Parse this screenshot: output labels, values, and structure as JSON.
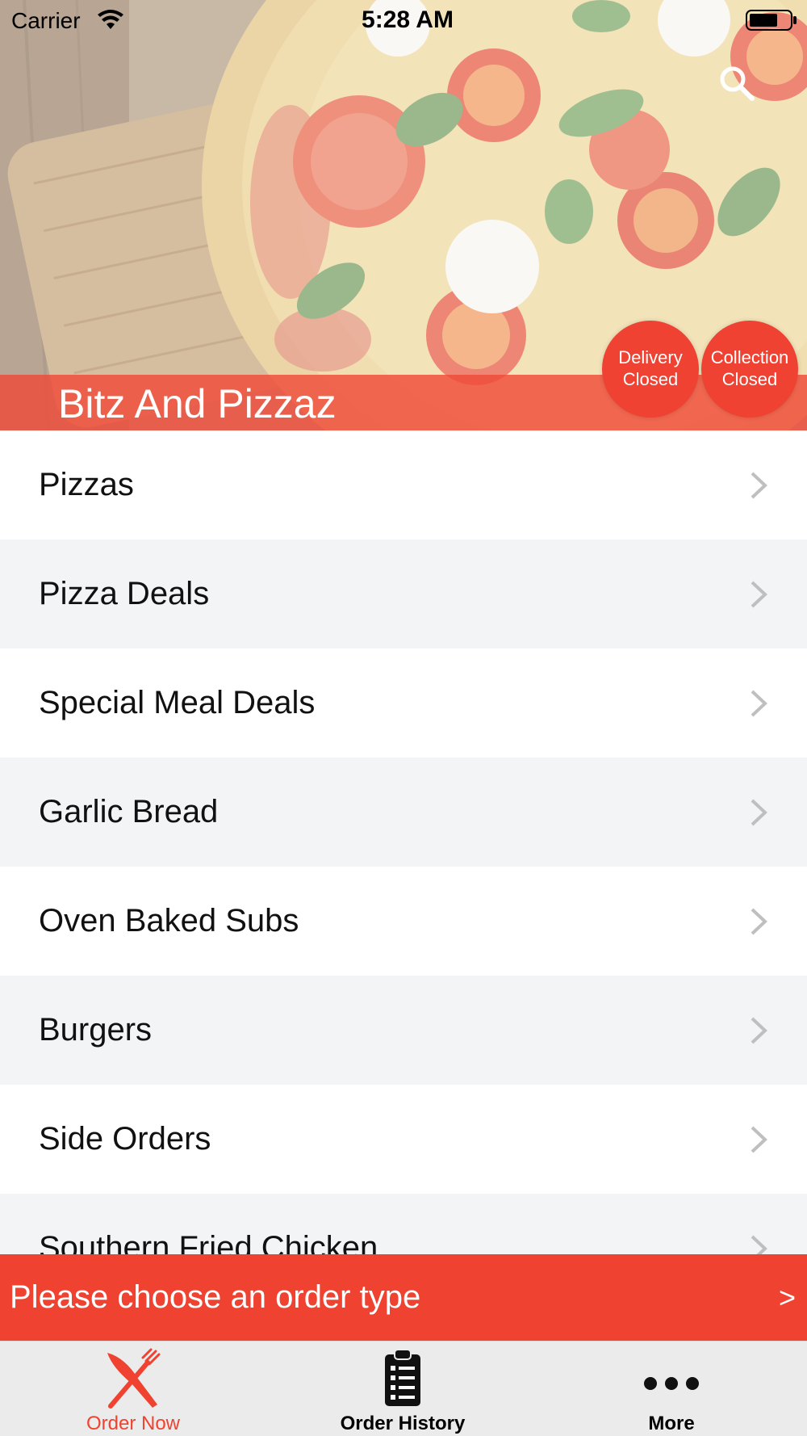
{
  "status_bar": {
    "carrier": "Carrier",
    "time": "5:28 AM"
  },
  "header": {
    "restaurant_name": "Bitz And Pizzaz",
    "delivery_status": [
      "Delivery",
      "Closed"
    ],
    "collection_status": [
      "Collection",
      "Closed"
    ]
  },
  "menu": {
    "items": [
      {
        "label": "Pizzas"
      },
      {
        "label": "Pizza Deals"
      },
      {
        "label": "Special Meal Deals"
      },
      {
        "label": "Garlic Bread"
      },
      {
        "label": "Oven Baked Subs"
      },
      {
        "label": "Burgers"
      },
      {
        "label": "Side Orders"
      },
      {
        "label": "Southern Fried Chicken"
      }
    ]
  },
  "order_bar": {
    "text": "Please choose an order type",
    "arrow": ">"
  },
  "tabs": [
    {
      "label": "Order Now",
      "icon": "fork-knife-icon",
      "active": true
    },
    {
      "label": "Order History",
      "icon": "clipboard-icon",
      "active": false
    },
    {
      "label": "More",
      "icon": "more-dots-icon",
      "active": false
    }
  ],
  "colors": {
    "accent": "#ef4230",
    "list_alt_row": "#f3f4f6",
    "tab_bar": "#ebebeb"
  }
}
